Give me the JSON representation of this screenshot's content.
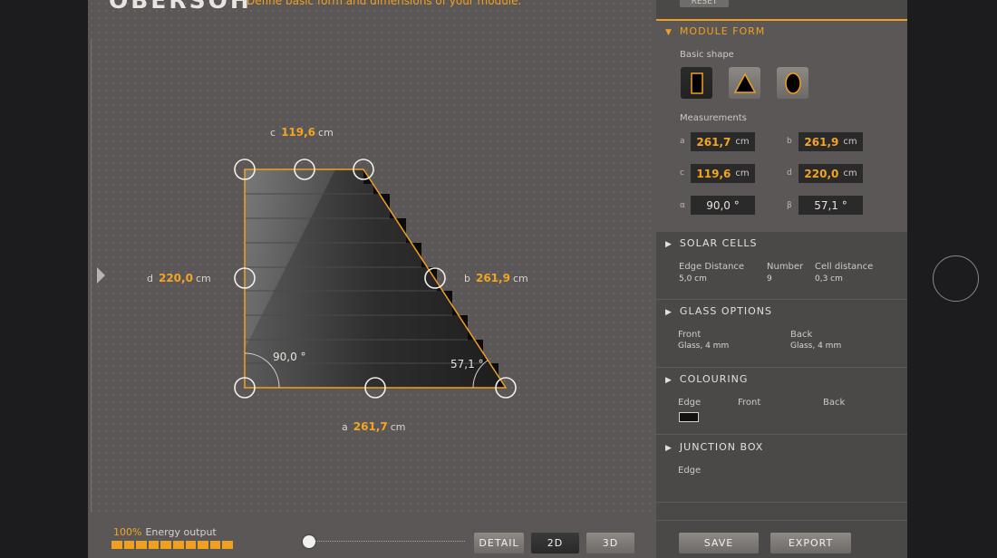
{
  "header": {
    "logo": "OBERSOH",
    "hint": "Define basic form and dimensions of your module."
  },
  "reset_label": "RESET",
  "dimensions": {
    "c": {
      "letter": "c",
      "value": "119,6",
      "unit": "cm"
    },
    "d": {
      "letter": "d",
      "value": "220,0",
      "unit": "cm"
    },
    "b": {
      "letter": "b",
      "value": "261,9",
      "unit": "cm"
    },
    "a": {
      "letter": "a",
      "value": "261,7",
      "unit": "cm"
    },
    "alpha": "90,0 °",
    "beta": "57,1 °"
  },
  "energy": {
    "percent": "100%",
    "label": "Energy output",
    "fraction": 1.0
  },
  "zoom": {
    "fraction": 0.0
  },
  "view_buttons": {
    "detail": "DETAIL",
    "two_d": "2D",
    "three_d": "3D",
    "active": "2D"
  },
  "module_form": {
    "title": "MODULE FORM",
    "basic_shape_label": "Basic shape",
    "shapes": [
      "rectangle-icon",
      "triangle-icon",
      "ellipse-icon"
    ],
    "active_shape": "rectangle-icon",
    "measurements_label": "Measurements",
    "fields": {
      "a": {
        "label": "a",
        "value": "261,7",
        "unit": "cm"
      },
      "b": {
        "label": "b",
        "value": "261,9",
        "unit": "cm"
      },
      "c": {
        "label": "c",
        "value": "119,6",
        "unit": "cm"
      },
      "d": {
        "label": "d",
        "value": "220,0",
        "unit": "cm"
      },
      "alpha": {
        "label": "α",
        "value": "90,0 °"
      },
      "beta": {
        "label": "β",
        "value": "57,1 °"
      }
    }
  },
  "solar_cells": {
    "title": "SOLAR CELLS",
    "edge_distance_label": "Edge Distance",
    "edge_distance_value": "5,0 cm",
    "number_label": "Number",
    "number_value": "9",
    "cell_distance_label": "Cell distance",
    "cell_distance_value": "0,3 cm"
  },
  "glass_options": {
    "title": "GLASS OPTIONS",
    "front_label": "Front",
    "front_value": "Glass, 4 mm",
    "back_label": "Back",
    "back_value": "Glass, 4 mm"
  },
  "colouring": {
    "title": "COLOURING",
    "edge_label": "Edge",
    "front_label": "Front",
    "back_label": "Back",
    "edge_color": "#111111"
  },
  "junction_box": {
    "title": "JUNCTION BOX",
    "edge_label": "Edge"
  },
  "footer": {
    "save": "SAVE",
    "export": "EXPORT"
  },
  "colors": {
    "accent": "#f0a020",
    "panel": "#4b4948",
    "canvas": "#5a5756"
  }
}
